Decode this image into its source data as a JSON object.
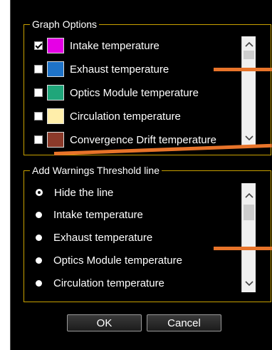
{
  "graph_options": {
    "title": "Graph Options",
    "items": [
      {
        "label": "Intake temperature",
        "checked": true,
        "color": "#e600e6"
      },
      {
        "label": "Exhaust temperature",
        "checked": false,
        "color": "#1e73c8"
      },
      {
        "label": "Optics Module temperature",
        "checked": false,
        "color": "#1fa67a"
      },
      {
        "label": "Circulation temperature",
        "checked": false,
        "color": "#ffeeaa"
      },
      {
        "label": "Convergence Drift temperature",
        "checked": false,
        "color": "#8b3a2a"
      }
    ]
  },
  "warnings": {
    "title": "Add Warnings Threshold line",
    "items": [
      {
        "label": "Hide the line",
        "selected": true
      },
      {
        "label": "Intake temperature",
        "selected": false
      },
      {
        "label": "Exhaust temperature",
        "selected": false
      },
      {
        "label": "Optics Module temperature",
        "selected": false
      },
      {
        "label": "Circulation temperature",
        "selected": false
      }
    ]
  },
  "buttons": {
    "ok": "OK",
    "cancel": "Cancel"
  },
  "colors": {
    "frame": "#c8a000",
    "callout": "#e8742a",
    "background": "#000000"
  }
}
